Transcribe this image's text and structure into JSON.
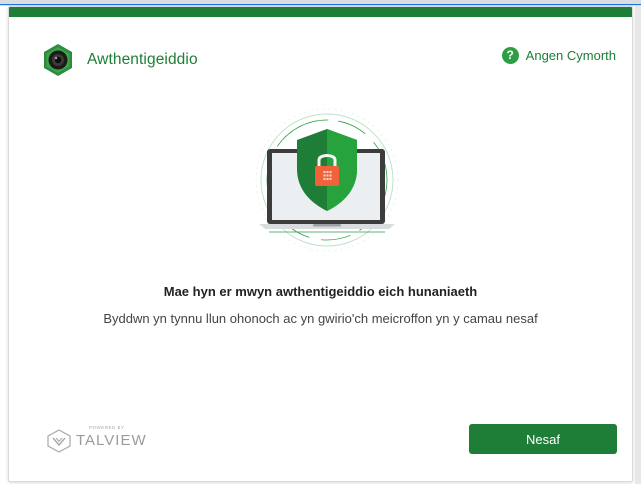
{
  "brand": {
    "title": "Awthentigeiddio"
  },
  "help": {
    "label": "Angen Cymorth",
    "icon": "question-circle-icon",
    "glyph": "?"
  },
  "content": {
    "headline": "Mae hyn er mwyn awthentigeiddio eich hunaniaeth",
    "subtext": "Byddwn yn tynnu llun ohonoch ac yn gwirio'ch meicroffon yn y camau nesaf"
  },
  "footer": {
    "powered_by": "POWERED BY",
    "brand": "TALVIEW",
    "next_label": "Nesaf"
  },
  "colors": {
    "primary_green": "#1e7d36",
    "help_green": "#2e9e44",
    "lock_orange": "#f0623a",
    "shield_green": "#26a33d"
  }
}
